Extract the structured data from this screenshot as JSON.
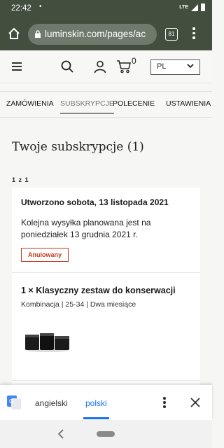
{
  "status_bar": {
    "time": "22:42",
    "dot": "•",
    "network": "LTE"
  },
  "browser": {
    "url": "luminskin.com/pages/ac",
    "tab_count": "81"
  },
  "header": {
    "cart_count": "0",
    "language": "PL"
  },
  "tabs": [
    {
      "label": "ZAMÓWIENIA"
    },
    {
      "label": "SUBSKRYPCJE"
    },
    {
      "label": "POLECENIE"
    },
    {
      "label": "USTAWIENIA"
    }
  ],
  "page": {
    "title": "Twoje subskrypcje (1)",
    "pager": "1 z 1"
  },
  "subscription": {
    "created": "Utworzono sobota, 13 listopada 2021",
    "next_shipment": "Kolejna wysyłka planowana jest na poniedziałek 13 grudnia 2021 r.",
    "status": "Anulowany",
    "product_title": "1 × Klasyczny zestaw do konserwacji",
    "product_meta": "Kombinacja | 25-34 | Dwa miesiące"
  },
  "translate_bar": {
    "source_lang": "angielski",
    "target_lang": "polski"
  },
  "colors": {
    "browser_bar": "#424f3f",
    "accent_red": "#c0391b",
    "translate_blue": "#1a73e8"
  }
}
